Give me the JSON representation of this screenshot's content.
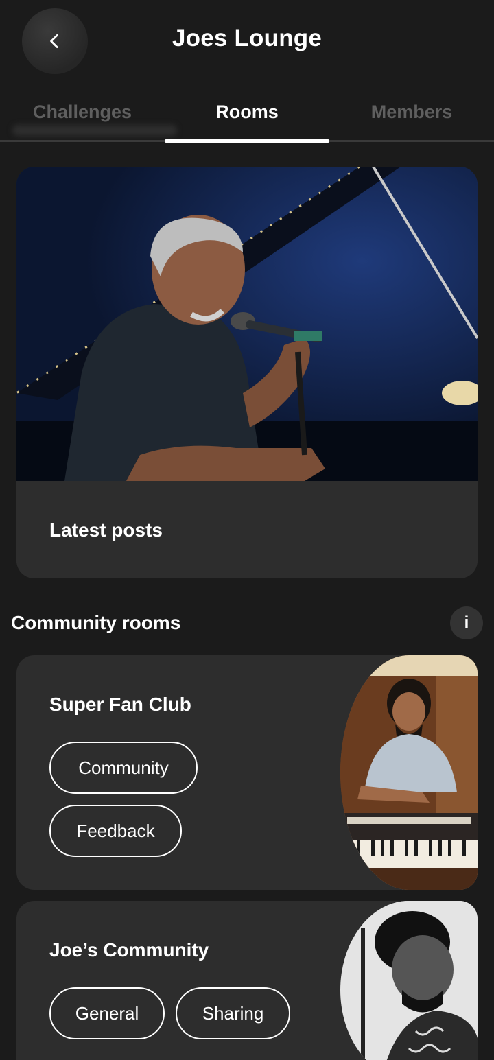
{
  "header": {
    "title": "Joes Lounge",
    "back_icon": "chevron-left-icon"
  },
  "tabs": [
    {
      "label": "Challenges",
      "active": false
    },
    {
      "label": "Rooms",
      "active": true
    },
    {
      "label": "Members",
      "active": false
    }
  ],
  "hero": {
    "footer_title": "Latest posts"
  },
  "community": {
    "section_title": "Community rooms",
    "info_label": "i",
    "rooms": [
      {
        "name": "Super Fan Club",
        "tags": [
          "Community",
          "Feedback"
        ]
      },
      {
        "name": "Joe’s Community",
        "tags": [
          "General",
          "Sharing"
        ]
      }
    ]
  },
  "colors": {
    "background": "#1b1b1b",
    "card": "#2d2d2d",
    "inactive_tab": "#5f5f5f",
    "accent": "#ffffff"
  }
}
